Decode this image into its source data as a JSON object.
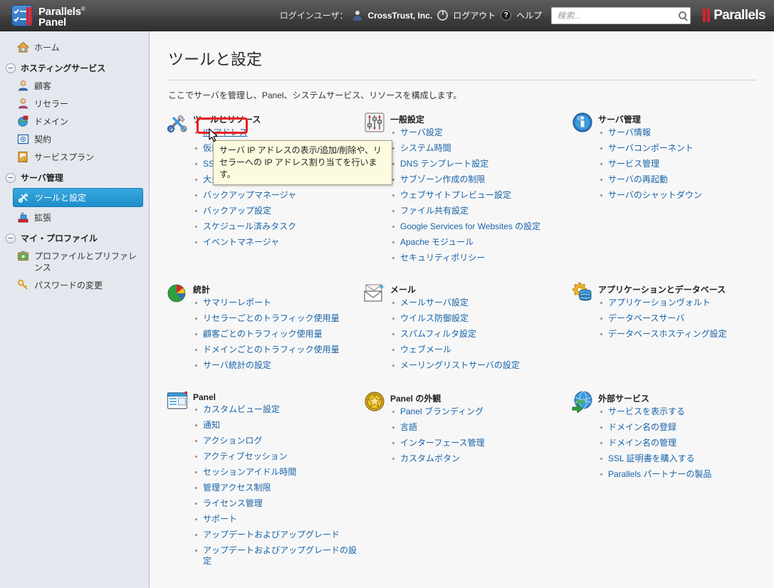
{
  "header": {
    "logo_title_line1": "Parallels",
    "logo_title_line2": "Panel",
    "logo_reg": "®",
    "login_user_label": "ログインユーザ：",
    "user_name": "CrossTrust, Inc.",
    "logout_label": "ログアウト",
    "help_label": "ヘルプ",
    "help_glyph": "?",
    "search_placeholder": "検索...",
    "search_value": "",
    "brand_logo": "Parallels",
    "accent_red": "#d9232e",
    "bar_bg": "#3d3d3d"
  },
  "sidebar": {
    "home": {
      "label": "ホーム",
      "icon": "home-icon"
    },
    "groups": [
      {
        "title": "ホスティングサービス",
        "items": [
          {
            "label": "顧客",
            "icon": "customer-icon",
            "selected": false
          },
          {
            "label": "リセラー",
            "icon": "reseller-icon",
            "selected": false
          },
          {
            "label": "ドメイン",
            "icon": "domain-icon",
            "selected": false
          },
          {
            "label": "契約",
            "icon": "subscription-icon",
            "selected": false
          },
          {
            "label": "サービスプラン",
            "icon": "service-plan-icon",
            "selected": false
          }
        ]
      },
      {
        "title": "サーバ管理",
        "items": [
          {
            "label": "ツールと設定",
            "icon": "tools-settings-icon",
            "selected": true
          },
          {
            "label": "拡張",
            "icon": "extensions-icon",
            "selected": false
          }
        ]
      },
      {
        "title": "マイ・プロファイル",
        "items": [
          {
            "label": "プロファイルとプリファレンス",
            "icon": "profile-icon",
            "selected": false
          },
          {
            "label": "パスワードの変更",
            "icon": "key-icon",
            "selected": false
          }
        ]
      }
    ],
    "selected_bg": "#1e8ecb"
  },
  "main": {
    "title": "ツールと設定",
    "description": "ここでサーバを管理し、Panel、システムサービス、リソースを構成します。",
    "link_color": "#1763a8",
    "groups": [
      {
        "title": "ツールとリソース",
        "icon": "tools-resources-icon",
        "items": [
          "IP アドレス",
          "仮想ホストテンプレート",
          "SSL 証明書",
          "大量メールメッセージ",
          "バックアップマネージャ",
          "バックアップ設定",
          "スケジュール済みタスク",
          "イベントマネージャ"
        ]
      },
      {
        "title": "一般設定",
        "icon": "general-settings-icon",
        "items": [
          "サーバ設定",
          "システム時間",
          "DNS テンプレート設定",
          "サブゾーン作成の制限",
          "ウェブサイトプレビュー設定",
          "ファイル共有設定",
          "Google Services for Websites の設定",
          "Apache モジュール",
          "セキュリティポリシー"
        ]
      },
      {
        "title": "サーバ管理",
        "icon": "server-info-icon",
        "items": [
          "サーバ情報",
          "サーバコンポーネント",
          "サービス管理",
          "サーバの再起動",
          "サーバのシャットダウン"
        ]
      },
      {
        "title": "統計",
        "icon": "statistics-pie-icon",
        "items": [
          "サマリーレポート",
          "リセラーごとのトラフィック使用量",
          "顧客ごとのトラフィック使用量",
          "ドメインごとのトラフィック使用量",
          "サーバ統計の設定"
        ]
      },
      {
        "title": "メール",
        "icon": "mail-icon",
        "items": [
          "メールサーバ設定",
          "ウイルス防御設定",
          "スパムフィルタ設定",
          "ウェブメール",
          "メーリングリストサーバの設定"
        ]
      },
      {
        "title": "アプリケーションとデータベース",
        "icon": "applications-db-icon",
        "items": [
          "アプリケーションヴォルト",
          "データベースサーバ",
          "データベースホスティング設定"
        ]
      },
      {
        "title": "Panel",
        "icon": "panel-icon",
        "items": [
          "カスタムビュー設定",
          "通知",
          "アクションログ",
          "アクティブセッション",
          "セッションアイドル時間",
          "管理アクセス制限",
          "ライセンス管理",
          "サポート",
          "アップデートおよびアップグレード",
          "アップデートおよびアップグレードの設定"
        ]
      },
      {
        "title": "Panel の外観",
        "icon": "panel-appearance-icon",
        "items": [
          "Panel ブランディング",
          "言語",
          "インターフェース管理",
          "カスタムボタン"
        ]
      },
      {
        "title": "外部サービス",
        "icon": "external-services-icon",
        "items": [
          "サービスを表示する",
          "ドメイン名の登録",
          "ドメイン名の管理",
          "SSL 証明書を購入する",
          "Parallels パートナーの製品"
        ]
      }
    ]
  },
  "tooltip": {
    "text": "サーバ IP アドレスの表示/追加/削除や、リセラーへの IP アドレス割り当てを行います。",
    "bg": "#fcfbdf"
  },
  "highlight": {
    "target_label": "IP アドレス",
    "color": "#ec1c24"
  }
}
